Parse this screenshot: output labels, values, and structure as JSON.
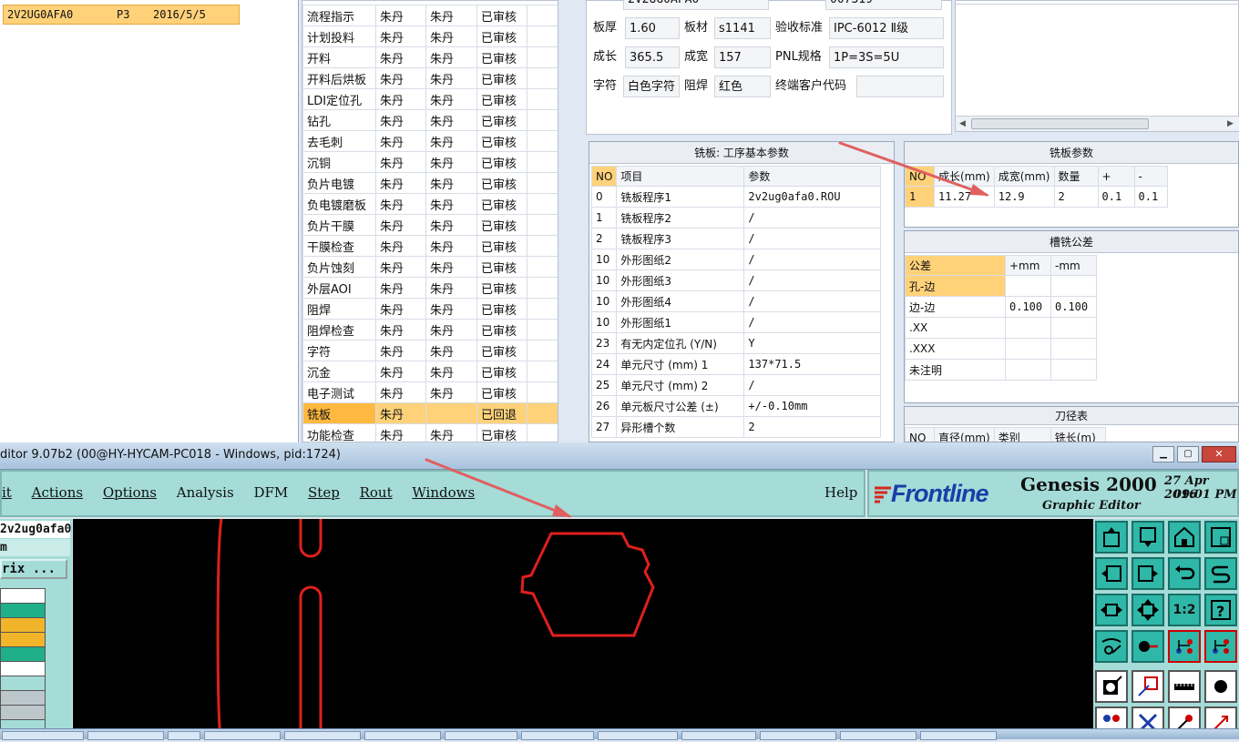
{
  "job_list": {
    "row": {
      "job": "2V2UG0AFA0",
      "layer": "P3",
      "date": "2016/5/5"
    }
  },
  "process_list": {
    "rows": [
      [
        "流程指示",
        "朱丹",
        "朱丹",
        "已审核"
      ],
      [
        "计划投料",
        "朱丹",
        "朱丹",
        "已审核"
      ],
      [
        "开料",
        "朱丹",
        "朱丹",
        "已审核"
      ],
      [
        "开料后烘板",
        "朱丹",
        "朱丹",
        "已审核"
      ],
      [
        "LDI定位孔",
        "朱丹",
        "朱丹",
        "已审核"
      ],
      [
        "钻孔",
        "朱丹",
        "朱丹",
        "已审核"
      ],
      [
        "去毛刺",
        "朱丹",
        "朱丹",
        "已审核"
      ],
      [
        "沉铜",
        "朱丹",
        "朱丹",
        "已审核"
      ],
      [
        "负片电镀",
        "朱丹",
        "朱丹",
        "已审核"
      ],
      [
        "负电镀磨板",
        "朱丹",
        "朱丹",
        "已审核"
      ],
      [
        "负片干膜",
        "朱丹",
        "朱丹",
        "已审核"
      ],
      [
        "干膜检查",
        "朱丹",
        "朱丹",
        "已审核"
      ],
      [
        "负片蚀刻",
        "朱丹",
        "朱丹",
        "已审核"
      ],
      [
        "外层AOI",
        "朱丹",
        "朱丹",
        "已审核"
      ],
      [
        "阻焊",
        "朱丹",
        "朱丹",
        "已审核"
      ],
      [
        "阻焊检查",
        "朱丹",
        "朱丹",
        "已审核"
      ],
      [
        "字符",
        "朱丹",
        "朱丹",
        "已审核"
      ],
      [
        "沉金",
        "朱丹",
        "朱丹",
        "已审核"
      ],
      [
        "电子测试",
        "朱丹",
        "朱丹",
        "已审核"
      ],
      [
        "铣板",
        "朱丹",
        "",
        "已回退"
      ],
      [
        "功能检查",
        "朱丹",
        "朱丹",
        "已审核"
      ]
    ]
  },
  "board_info": {
    "top_partial": {
      "value1": "2V2UG0AFA0",
      "value2": "007319"
    },
    "thickness_label": "板厚",
    "thickness": "1.60",
    "material_label": "板材",
    "material": "s1141",
    "standard_label": "验收标准",
    "standard": "IPC-6012 Ⅱ级",
    "length_label": "成长",
    "length": "365.5",
    "width_label": "成宽",
    "width": "157",
    "pnl_label": "PNL规格",
    "pnl": "1P=3S=5U",
    "char_label": "字符",
    "char": "白色字符",
    "mask_label": "阻焊",
    "mask": "红色",
    "customer_label": "终端客户代码",
    "customer": ""
  },
  "milling_params": {
    "title": "铣板: 工序基本参数",
    "col_no": "NO",
    "col_item": "项目",
    "col_param": "参数",
    "rows": [
      [
        "0",
        "铣板程序1",
        "2v2ug0afa0.ROU"
      ],
      [
        "1",
        "铣板程序2",
        "/"
      ],
      [
        "2",
        "铣板程序3",
        "/"
      ],
      [
        "10",
        "外形图纸2",
        "/"
      ],
      [
        "10",
        "外形图纸3",
        "/"
      ],
      [
        "10",
        "外形图纸4",
        "/"
      ],
      [
        "10",
        "外形图纸1",
        "/"
      ],
      [
        "23",
        "有无内定位孔 (Y/N)",
        "Y"
      ],
      [
        "24",
        "单元尺寸 (mm) 1",
        "137*71.5"
      ],
      [
        "25",
        "单元尺寸 (mm) 2",
        "/"
      ],
      [
        "26",
        "单元板尺寸公差 (±)",
        "+/-0.10mm"
      ],
      [
        "27",
        "异形槽个数",
        "2"
      ]
    ]
  },
  "mill_table": {
    "title": "铣板参数",
    "cols": [
      "NO",
      "成长(mm)",
      "成宽(mm)",
      "数量",
      "+",
      "-"
    ],
    "row": [
      "1",
      "11.27",
      "12.9",
      "2",
      "0.1",
      "0.1"
    ]
  },
  "slot_tol": {
    "title": "槽铣公差",
    "cols": [
      "公差",
      "+mm",
      "-mm"
    ],
    "rows": [
      [
        "孔-边",
        "",
        ""
      ],
      [
        "边-边",
        "0.100",
        "0.100"
      ],
      [
        ".XX",
        "",
        ""
      ],
      [
        ".XXX",
        "",
        ""
      ],
      [
        "未注明",
        "",
        ""
      ]
    ]
  },
  "tool_table": {
    "title": "刀径表",
    "cols": [
      "NO",
      "直径(mm)",
      "类别",
      "铣长(m)"
    ]
  },
  "genesis": {
    "title": "ditor 9.07b2 (00@HY-HYCAM-PC018 - Windows, pid:1724)",
    "menu": [
      "it",
      "Actions",
      "Options",
      "Analysis",
      "DFM",
      "Step",
      "Rout",
      "Windows"
    ],
    "help": "Help",
    "brand": "Frontline",
    "product": "Genesis 2000",
    "subtitle": "Graphic Editor",
    "date": "27 Apr 2016",
    "time": "09:01 PM",
    "job_name": "2v2ug0afa0",
    "step_partial": "m",
    "matrix_btn": "rix ...",
    "ratio_label": "1:2"
  },
  "colors": {
    "accent": "#2fb7a8",
    "selection": "#ffd27a",
    "outline": "#e0201c",
    "arrow": "#e06060"
  }
}
